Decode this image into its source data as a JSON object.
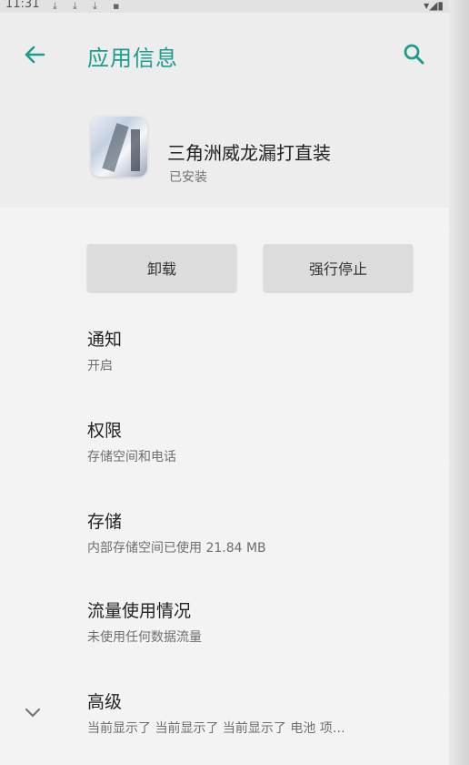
{
  "status_bar": {
    "time": "11:31",
    "download_glyph": "⤓",
    "right_icons": "▾◢▮"
  },
  "toolbar": {
    "back_icon": "arrow-left-icon",
    "title": "应用信息",
    "search_icon": "search-icon"
  },
  "app": {
    "name": "三角洲威龙漏打直装",
    "status": "已安装"
  },
  "buttons": {
    "uninstall": "卸载",
    "force_stop": "强行停止"
  },
  "prefs": {
    "notifications": {
      "title": "通知",
      "summary": "开启"
    },
    "permissions": {
      "title": "权限",
      "summary": "存储空间和电话"
    },
    "storage": {
      "title": "存储",
      "summary": "内部存储空间已使用 21.84 MB"
    },
    "data_usage": {
      "title": "流量使用情况",
      "summary": "未使用任何数据流量"
    },
    "advanced": {
      "title": "高级",
      "summary": "当前显示了 当前显示了 当前显示了 电池 项…"
    }
  },
  "colors": {
    "accent": "#1c9c8c",
    "header_bg": "#ededed",
    "page_bg": "#f3f3f3",
    "button_bg": "#dcdcdc"
  }
}
